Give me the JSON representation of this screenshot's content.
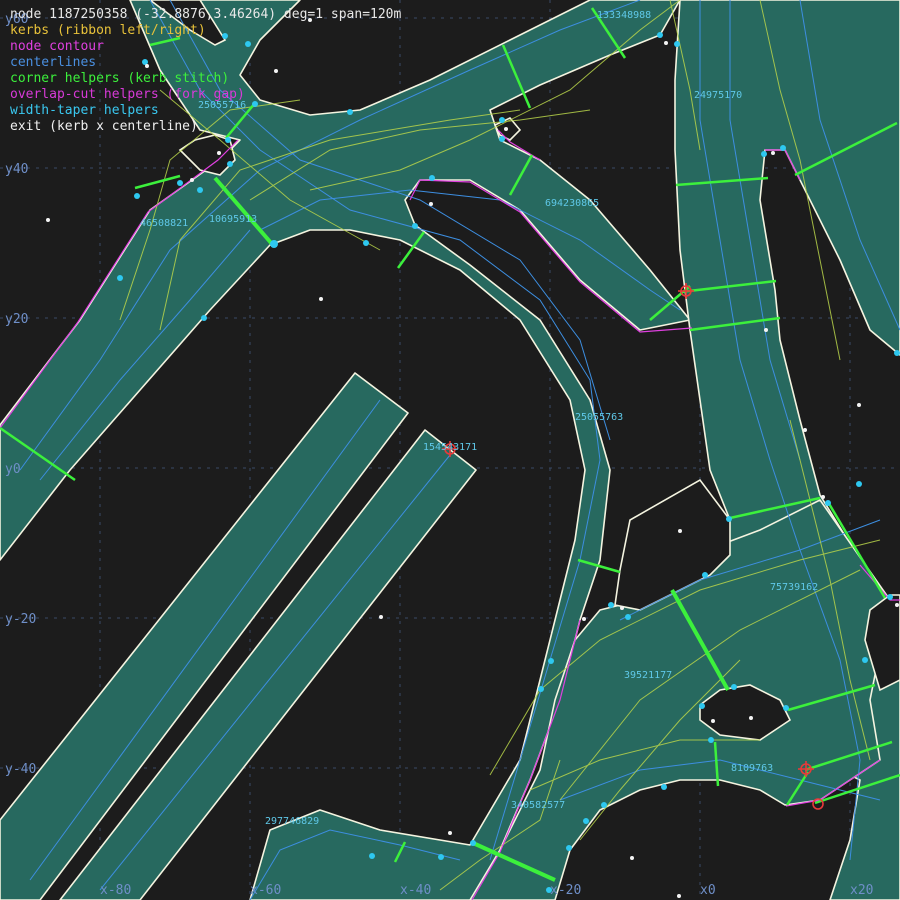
{
  "header": {
    "node_line": "node 1187250358 (-32.8876,3.46264) deg=1 span=120m"
  },
  "legend": [
    {
      "label": "kerbs (ribbon left/right)",
      "color": "#e8c23a"
    },
    {
      "label": "node contour",
      "color": "#e040e0"
    },
    {
      "label": "centerlines",
      "color": "#4a8fe0"
    },
    {
      "label": "corner helpers (kerb stitch)",
      "color": "#3cf03c"
    },
    {
      "label": "overlap-cut helpers (fork gap)",
      "color": "#d83ad8"
    },
    {
      "label": "width-taper helpers",
      "color": "#3ac8f0"
    },
    {
      "label": "exit (kerb x centerline)",
      "color": "#f0f0f0"
    }
  ],
  "grid": {
    "x_labels": [
      "x-80",
      "x-60",
      "x-40",
      "x-20",
      "x0",
      "x20"
    ],
    "y_labels": [
      "y60",
      "y40",
      "y20",
      "y0",
      "y-20",
      "y-40"
    ]
  },
  "road_ids": [
    "133348988",
    "24975170",
    "25055716",
    "694230865",
    "46508821",
    "10695913",
    "25055763",
    "154543171",
    "75739162",
    "39521177",
    "8109763",
    "340582577",
    "297746829"
  ],
  "colors": {
    "background": "#1c1c1c",
    "road_fill": "#27695f",
    "kerb": "#f4f4e0",
    "contour": "#e040e0",
    "stitch": "#3cf03c",
    "centerline": "#3d8ee0",
    "helper_curve": "#b8d44a",
    "taper_dot": "#2ec8f0",
    "marker": "#e83a3a"
  }
}
